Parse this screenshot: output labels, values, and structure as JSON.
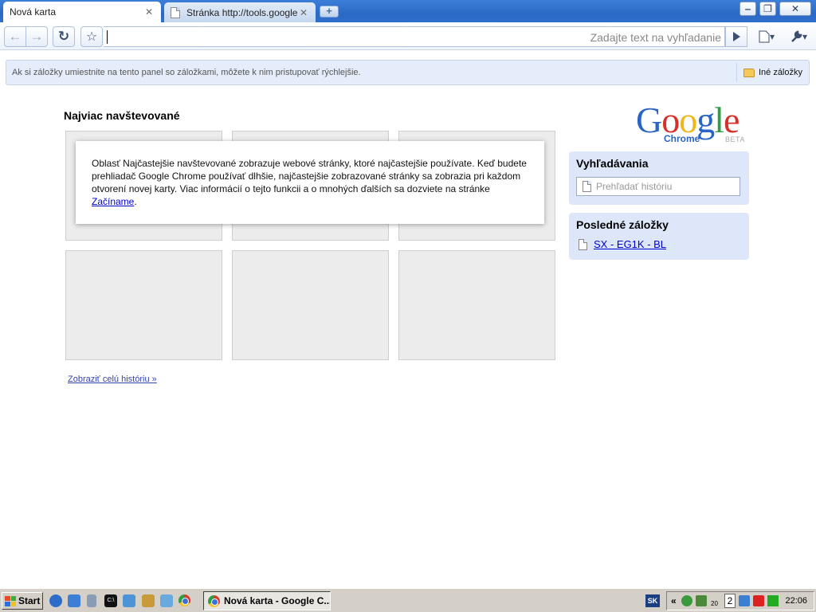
{
  "window": {
    "tabs": [
      {
        "title": "Nová karta",
        "close": "✕"
      },
      {
        "title": "Stránka http://tools.google...",
        "close": "✕"
      }
    ],
    "new_tab": "+",
    "controls": {
      "minimize": "‒",
      "maximize": "❐",
      "close": "✕"
    }
  },
  "toolbar": {
    "back": "←",
    "forward": "→",
    "reload": "↻",
    "star": "☆",
    "omnibox_value": "",
    "omnibox_hint": "Zadajte text na vyhľadanie",
    "page_menu": "▾",
    "wrench_menu": "▾"
  },
  "bookmark_bar": {
    "hint": "Ak si záložky umiestnite na tento panel so záložkami, môžete k nim pristupovať rýchlejšie.",
    "other_bookmarks": "Iné záložky"
  },
  "new_tab_page": {
    "most_visited_title": "Najviac navštevované",
    "thumbnail_count": 6,
    "info_text": "Oblasť Najčastejšie navštevované zobrazuje webové stránky, ktoré najčastejšie používate. Keď budete prehliadač Google Chrome používať dlhšie, najčastejšie zobrazované stránky sa zobrazia pri každom otvorení novej karty. Viac informácií o tejto funkcii a o mnohých ďalších sa dozviete na stránke",
    "info_link": "Začíname",
    "info_end": ".",
    "history_link": "Zobraziť celú históriu »",
    "logo": {
      "word": "Google",
      "product": "Chrome",
      "tag": "BETA"
    },
    "searches": {
      "title": "Vyhľadávania",
      "placeholder": "Prehľadať históriu"
    },
    "recent_bookmarks": {
      "title": "Posledné záložky",
      "items": [
        {
          "label": "SX - EG1K - BL"
        }
      ]
    }
  },
  "taskbar": {
    "start": "Start",
    "active_task": "Nová karta - Google C...",
    "language": "SK",
    "tray_chevron": "«",
    "tray_number": "2",
    "tray_small": "20",
    "clock": "22:06"
  }
}
